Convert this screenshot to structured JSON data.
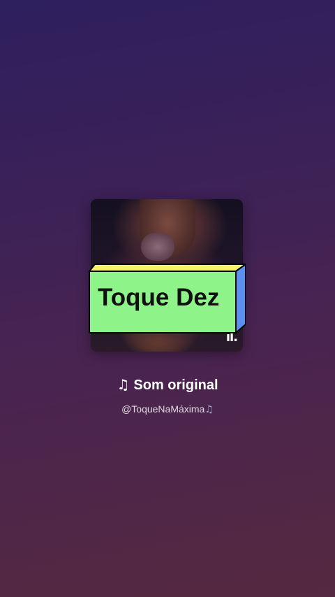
{
  "sound": {
    "badge_text": "Toque Dez",
    "title": "Som original",
    "title_icon": "music-note-icon",
    "author": "@ToqueNaMáxima",
    "author_icon": "music-note-icon",
    "cover_icon": "audio-bars-icon"
  },
  "colors": {
    "badge_front": "#8ef48a",
    "badge_top": "#f4f46a",
    "badge_side": "#5b8ff0",
    "badge_border": "#000000"
  }
}
